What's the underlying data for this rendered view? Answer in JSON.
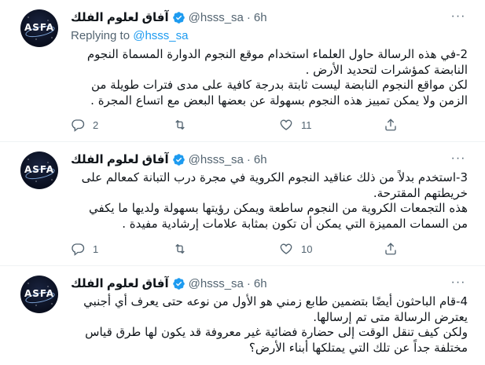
{
  "tweets": [
    {
      "display_name": "آفاق لعلوم الفلك",
      "handle": "@hsss_sa",
      "separator": "·",
      "time": "6h",
      "avatar_text": "ASFA",
      "replying_to_label": "Replying to",
      "replying_to_handle": "@hsss_sa",
      "paragraphs": [
        "2-في هذه الرسالة حاول العلماء استخدام موقع النجوم الدوارة المسماة النجوم النابضة كمؤشرات لتحديد الأرض .",
        "لكن مواقع النجوم النابضة ليست ثابتة بدرجة كافية على مدى فترات طويلة من الزمن ولا يمكن تمييز هذه النجوم بسهولة عن بعضها البعض مع اتساع المجرة ."
      ],
      "replies": "2",
      "retweets": "",
      "likes": "11"
    },
    {
      "display_name": "آفاق لعلوم الفلك",
      "handle": "@hsss_sa",
      "separator": "·",
      "time": "6h",
      "avatar_text": "ASFA",
      "paragraphs": [
        "3-استخدم بدلاً من ذلك عناقيد النجوم الكروية في مجرة درب التبانة كمعالم على خريطتهم المقترحة.",
        "هذه التجمعات الكروية من النجوم ساطعة ويمكن رؤيتها بسهولة ولديها ما يكفي من السمات المميزة التي يمكن أن تكون بمثابة علامات إرشادية مفيدة ."
      ],
      "replies": "1",
      "retweets": "",
      "likes": "10"
    },
    {
      "display_name": "آفاق لعلوم الفلك",
      "handle": "@hsss_sa",
      "separator": "·",
      "time": "6h",
      "avatar_text": "ASFA",
      "paragraphs": [
        "4-قام الباحثون أيضًا بتضمين طابع زمني هو الأول من نوعه حتى يعرف أي أجنبي يعترض الرسالة متى تم إرسالها.",
        "ولكن كيف تنقل الوقت إلى حضارة فضائية غير معروفة قد يكون لها طرق قياس مختلفة جداً عن تلك التي يمتلكها أبناء الأرض؟"
      ]
    }
  ],
  "more_label": "···",
  "colors": {
    "accent": "#1d9bf0",
    "muted": "#536471",
    "text": "#0f1419",
    "border": "#eff3f4"
  }
}
